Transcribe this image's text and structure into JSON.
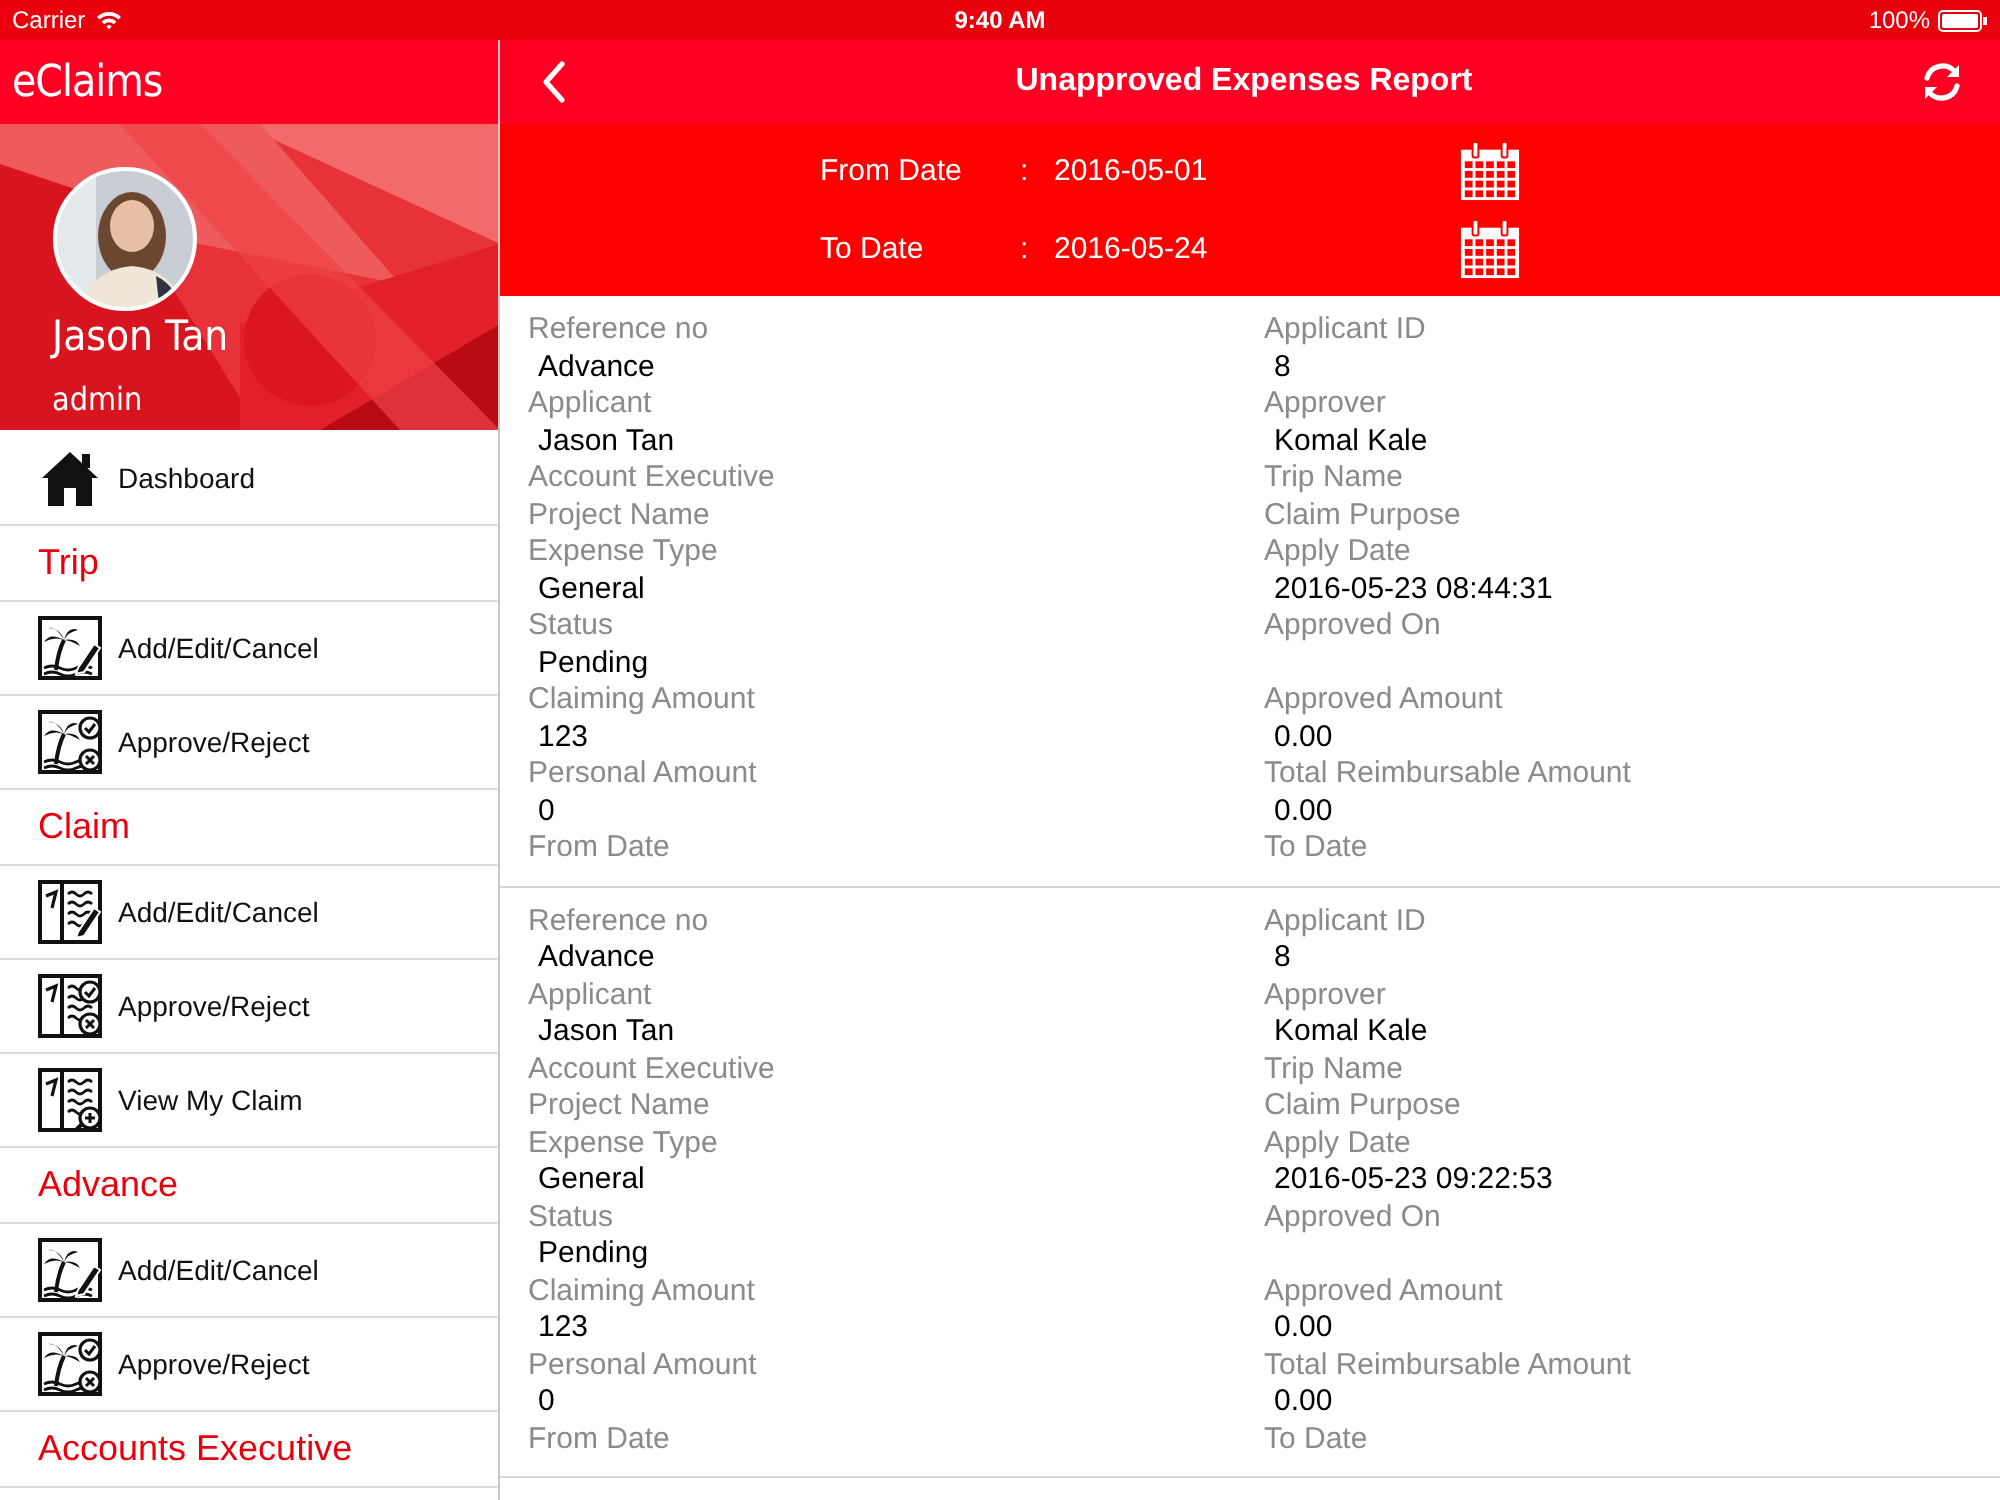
{
  "status_bar": {
    "carrier": "Carrier",
    "time": "9:40 AM",
    "battery": "100%"
  },
  "sidebar": {
    "app_title": "eClaims",
    "profile": {
      "name": "Jason Tan",
      "role": "admin"
    },
    "menu": [
      {
        "kind": "link",
        "label": "Dashboard"
      },
      {
        "kind": "section",
        "label": "Trip",
        "items": [
          {
            "label": "Add/Edit/Cancel"
          },
          {
            "label": "Approve/Reject"
          }
        ]
      },
      {
        "kind": "section",
        "label": "Claim",
        "items": [
          {
            "label": "Add/Edit/Cancel"
          },
          {
            "label": "Approve/Reject"
          },
          {
            "label": "View My Claim"
          }
        ]
      },
      {
        "kind": "section",
        "label": "Advance",
        "items": [
          {
            "label": "Add/Edit/Cancel"
          },
          {
            "label": "Approve/Reject"
          }
        ]
      },
      {
        "kind": "section",
        "label": "Accounts Executive"
      }
    ]
  },
  "header": {
    "title": "Unapproved Expenses Report"
  },
  "date_filter": [
    {
      "label": "From Date",
      "separator": ":",
      "value": "2016-05-01"
    },
    {
      "label": "To Date",
      "separator": ":",
      "value": "2016-05-24"
    }
  ],
  "records": [
    {
      "fields": [
        {
          "label": "Reference no",
          "value": "Advance"
        },
        {
          "label": "Applicant ID",
          "value": "8"
        },
        {
          "label": "Applicant",
          "value": "Jason Tan"
        },
        {
          "label": "Approver",
          "value": "Komal Kale"
        },
        {
          "label": "Account Executive"
        },
        {
          "label": "Trip Name"
        },
        {
          "label": "Project Name"
        },
        {
          "label": "Claim Purpose"
        },
        {
          "label": "Expense Type",
          "value": "General"
        },
        {
          "label": "Apply Date",
          "value": "2016-05-23 08:44:31"
        },
        {
          "label": "Status",
          "value": "Pending"
        },
        {
          "label": "Approved On"
        },
        {
          "label": "Claiming Amount",
          "value": "123"
        },
        {
          "label": "Approved Amount",
          "value": "0.00"
        },
        {
          "label": "Personal Amount",
          "value": "0"
        },
        {
          "label": "Total Reimbursable Amount",
          "value": "0.00"
        },
        {
          "label": "From Date"
        },
        {
          "label": "To Date"
        }
      ]
    },
    {
      "fields": [
        {
          "label": "Reference no",
          "value": "Advance"
        },
        {
          "label": "Applicant ID",
          "value": "8"
        },
        {
          "label": "Applicant",
          "value": "Jason Tan"
        },
        {
          "label": "Approver",
          "value": "Komal Kale"
        },
        {
          "label": "Account Executive"
        },
        {
          "label": "Trip Name"
        },
        {
          "label": "Project Name"
        },
        {
          "label": "Claim Purpose"
        },
        {
          "label": "Expense Type",
          "value": "General"
        },
        {
          "label": "Apply Date",
          "value": "2016-05-23 09:22:53"
        },
        {
          "label": "Status",
          "value": "Pending"
        },
        {
          "label": "Approved On"
        },
        {
          "label": "Claiming Amount",
          "value": "123"
        },
        {
          "label": "Approved Amount",
          "value": "0.00"
        },
        {
          "label": "Personal Amount",
          "value": "0"
        },
        {
          "label": "Total Reimbursable Amount",
          "value": "0.00"
        },
        {
          "label": "From Date"
        },
        {
          "label": "To Date"
        }
      ]
    }
  ]
}
